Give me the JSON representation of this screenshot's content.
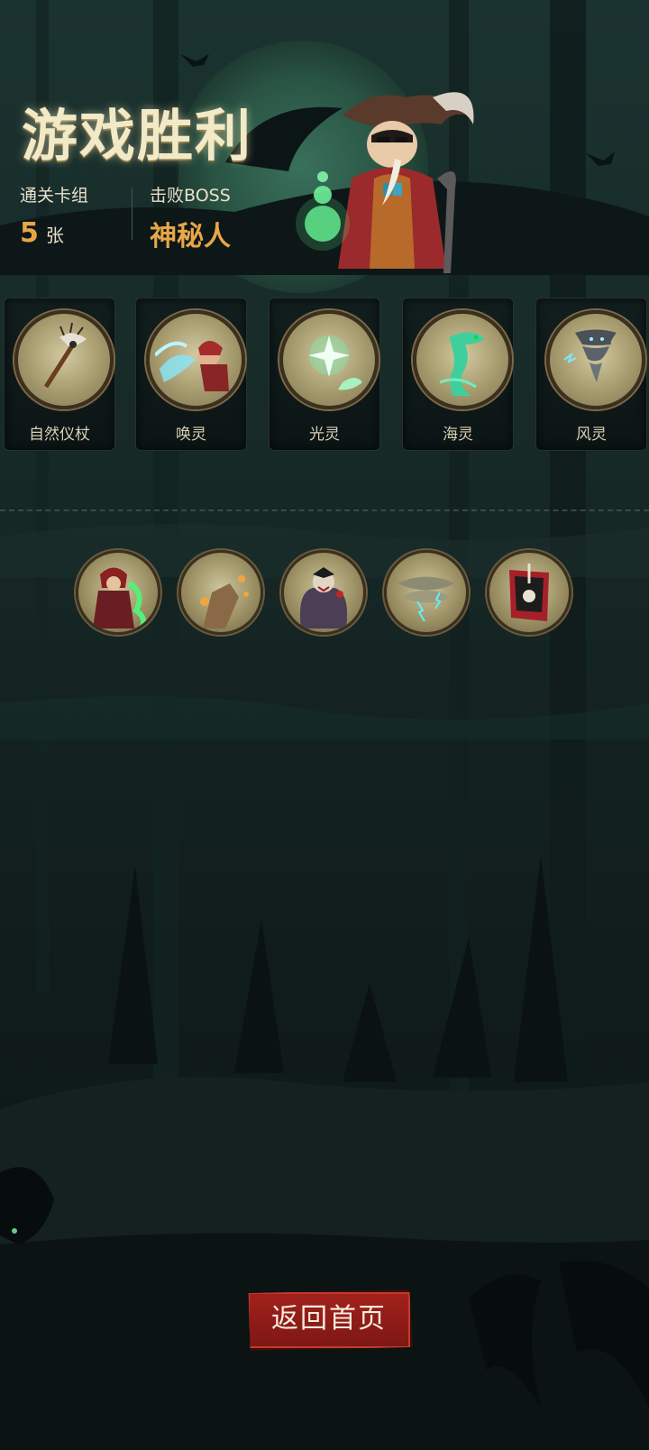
{
  "header": {
    "title": "游戏胜利",
    "stats": {
      "deck_label": "通关卡组",
      "deck_count": "5",
      "deck_unit": "张",
      "boss_label": "击败BOSS",
      "boss_name": "神秘人"
    }
  },
  "cards": [
    {
      "name": "自然仪杖",
      "icon": "staff-icon"
    },
    {
      "name": "唤灵",
      "icon": "summon-spirit-icon"
    },
    {
      "name": "光灵",
      "icon": "light-spirit-icon"
    },
    {
      "name": "海灵",
      "icon": "sea-spirit-icon"
    },
    {
      "name": "风灵",
      "icon": "wind-spirit-icon"
    }
  ],
  "relics": [
    {
      "icon": "red-hood-witch-icon"
    },
    {
      "icon": "candle-hand-icon"
    },
    {
      "icon": "vampire-icon"
    },
    {
      "icon": "lightning-storm-icon"
    },
    {
      "icon": "skull-banner-icon"
    }
  ],
  "home_button": {
    "label": "返回首页"
  },
  "colors": {
    "accent": "#e7a648",
    "button": "#9c1f1b",
    "title": "#f2e9c6"
  }
}
